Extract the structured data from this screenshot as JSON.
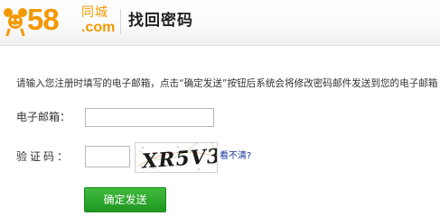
{
  "brand": {
    "number": "58",
    "name_cn": "同城",
    "domain": ".com",
    "color": "#f39800"
  },
  "page": {
    "title": "找回密码",
    "instructions": "请输入您注册时填写的电子邮箱，点击“确定发送”按钮后系统会将修改密码邮件发送到您的电子邮箱"
  },
  "form": {
    "email_label": "电子邮箱：",
    "email_value": "",
    "code_label": "验证码：",
    "code_value": "",
    "captcha_text": "XR5V3",
    "refresh_link": "看不清?",
    "submit_label": "确定发送",
    "submit_color": "#2aa82a"
  }
}
